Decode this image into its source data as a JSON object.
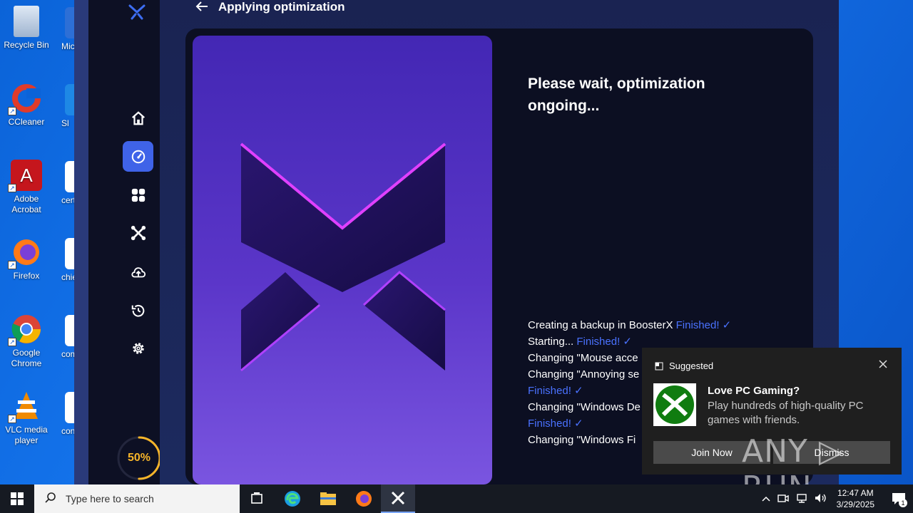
{
  "desktop": {
    "icons": [
      {
        "label": "Recycle Bin"
      },
      {
        "label": "CCleaner"
      },
      {
        "label": "Adobe Acrobat"
      },
      {
        "label": "Firefox"
      },
      {
        "label": "Google Chrome"
      },
      {
        "label": "VLC media player"
      }
    ],
    "partial_icons": [
      {
        "label": "Mic E"
      },
      {
        "label": "Sl"
      },
      {
        "label": "certi"
      },
      {
        "label": "chief"
      },
      {
        "label": "com"
      },
      {
        "label": "cons"
      }
    ]
  },
  "app": {
    "header": {
      "title": "Applying optimization",
      "back_icon": "arrow-left-icon"
    },
    "sidebar": {
      "items": [
        {
          "name": "home",
          "icon": "home-icon"
        },
        {
          "name": "optimize",
          "icon": "speedometer-icon",
          "active": true
        },
        {
          "name": "apps",
          "icon": "grid-icon"
        },
        {
          "name": "tools",
          "icon": "booster-icon"
        },
        {
          "name": "cloud",
          "icon": "cloud-upload-icon"
        },
        {
          "name": "history",
          "icon": "history-icon"
        },
        {
          "name": "settings",
          "icon": "gear-icon"
        }
      ],
      "progress": {
        "value": 0.5,
        "label": "50%",
        "color": "#f7b52a"
      }
    },
    "status_title": "Please wait, optimization ongoing...",
    "log": [
      {
        "text": "Creating a backup in BoosterX ",
        "finished": "Finished! ✓"
      },
      {
        "text": "Starting...  ",
        "finished": "Finished! ✓"
      },
      {
        "text": "Changing \"Mouse acce",
        "finished": ""
      },
      {
        "text": "Changing \"Annoying se",
        "finished": ""
      },
      {
        "text": "",
        "finished": "Finished! ✓"
      },
      {
        "text": "Changing \"Windows De",
        "finished": ""
      },
      {
        "text": "",
        "finished": "Finished! ✓"
      },
      {
        "text": "Changing \"Windows Fi",
        "finished": ""
      }
    ],
    "accent_color": "#4a72ff"
  },
  "toast": {
    "header": "Suggested",
    "title": "Love PC Gaming?",
    "body": "Play hundreds of high-quality PC games with friends.",
    "join_label": "Join Now",
    "dismiss_label": "Dismiss"
  },
  "watermark": "ANY ▷ RUN",
  "taskbar": {
    "search_placeholder": "Type here to search",
    "time": "12:47 AM",
    "date": "3/29/2025",
    "notification_count": "1"
  }
}
